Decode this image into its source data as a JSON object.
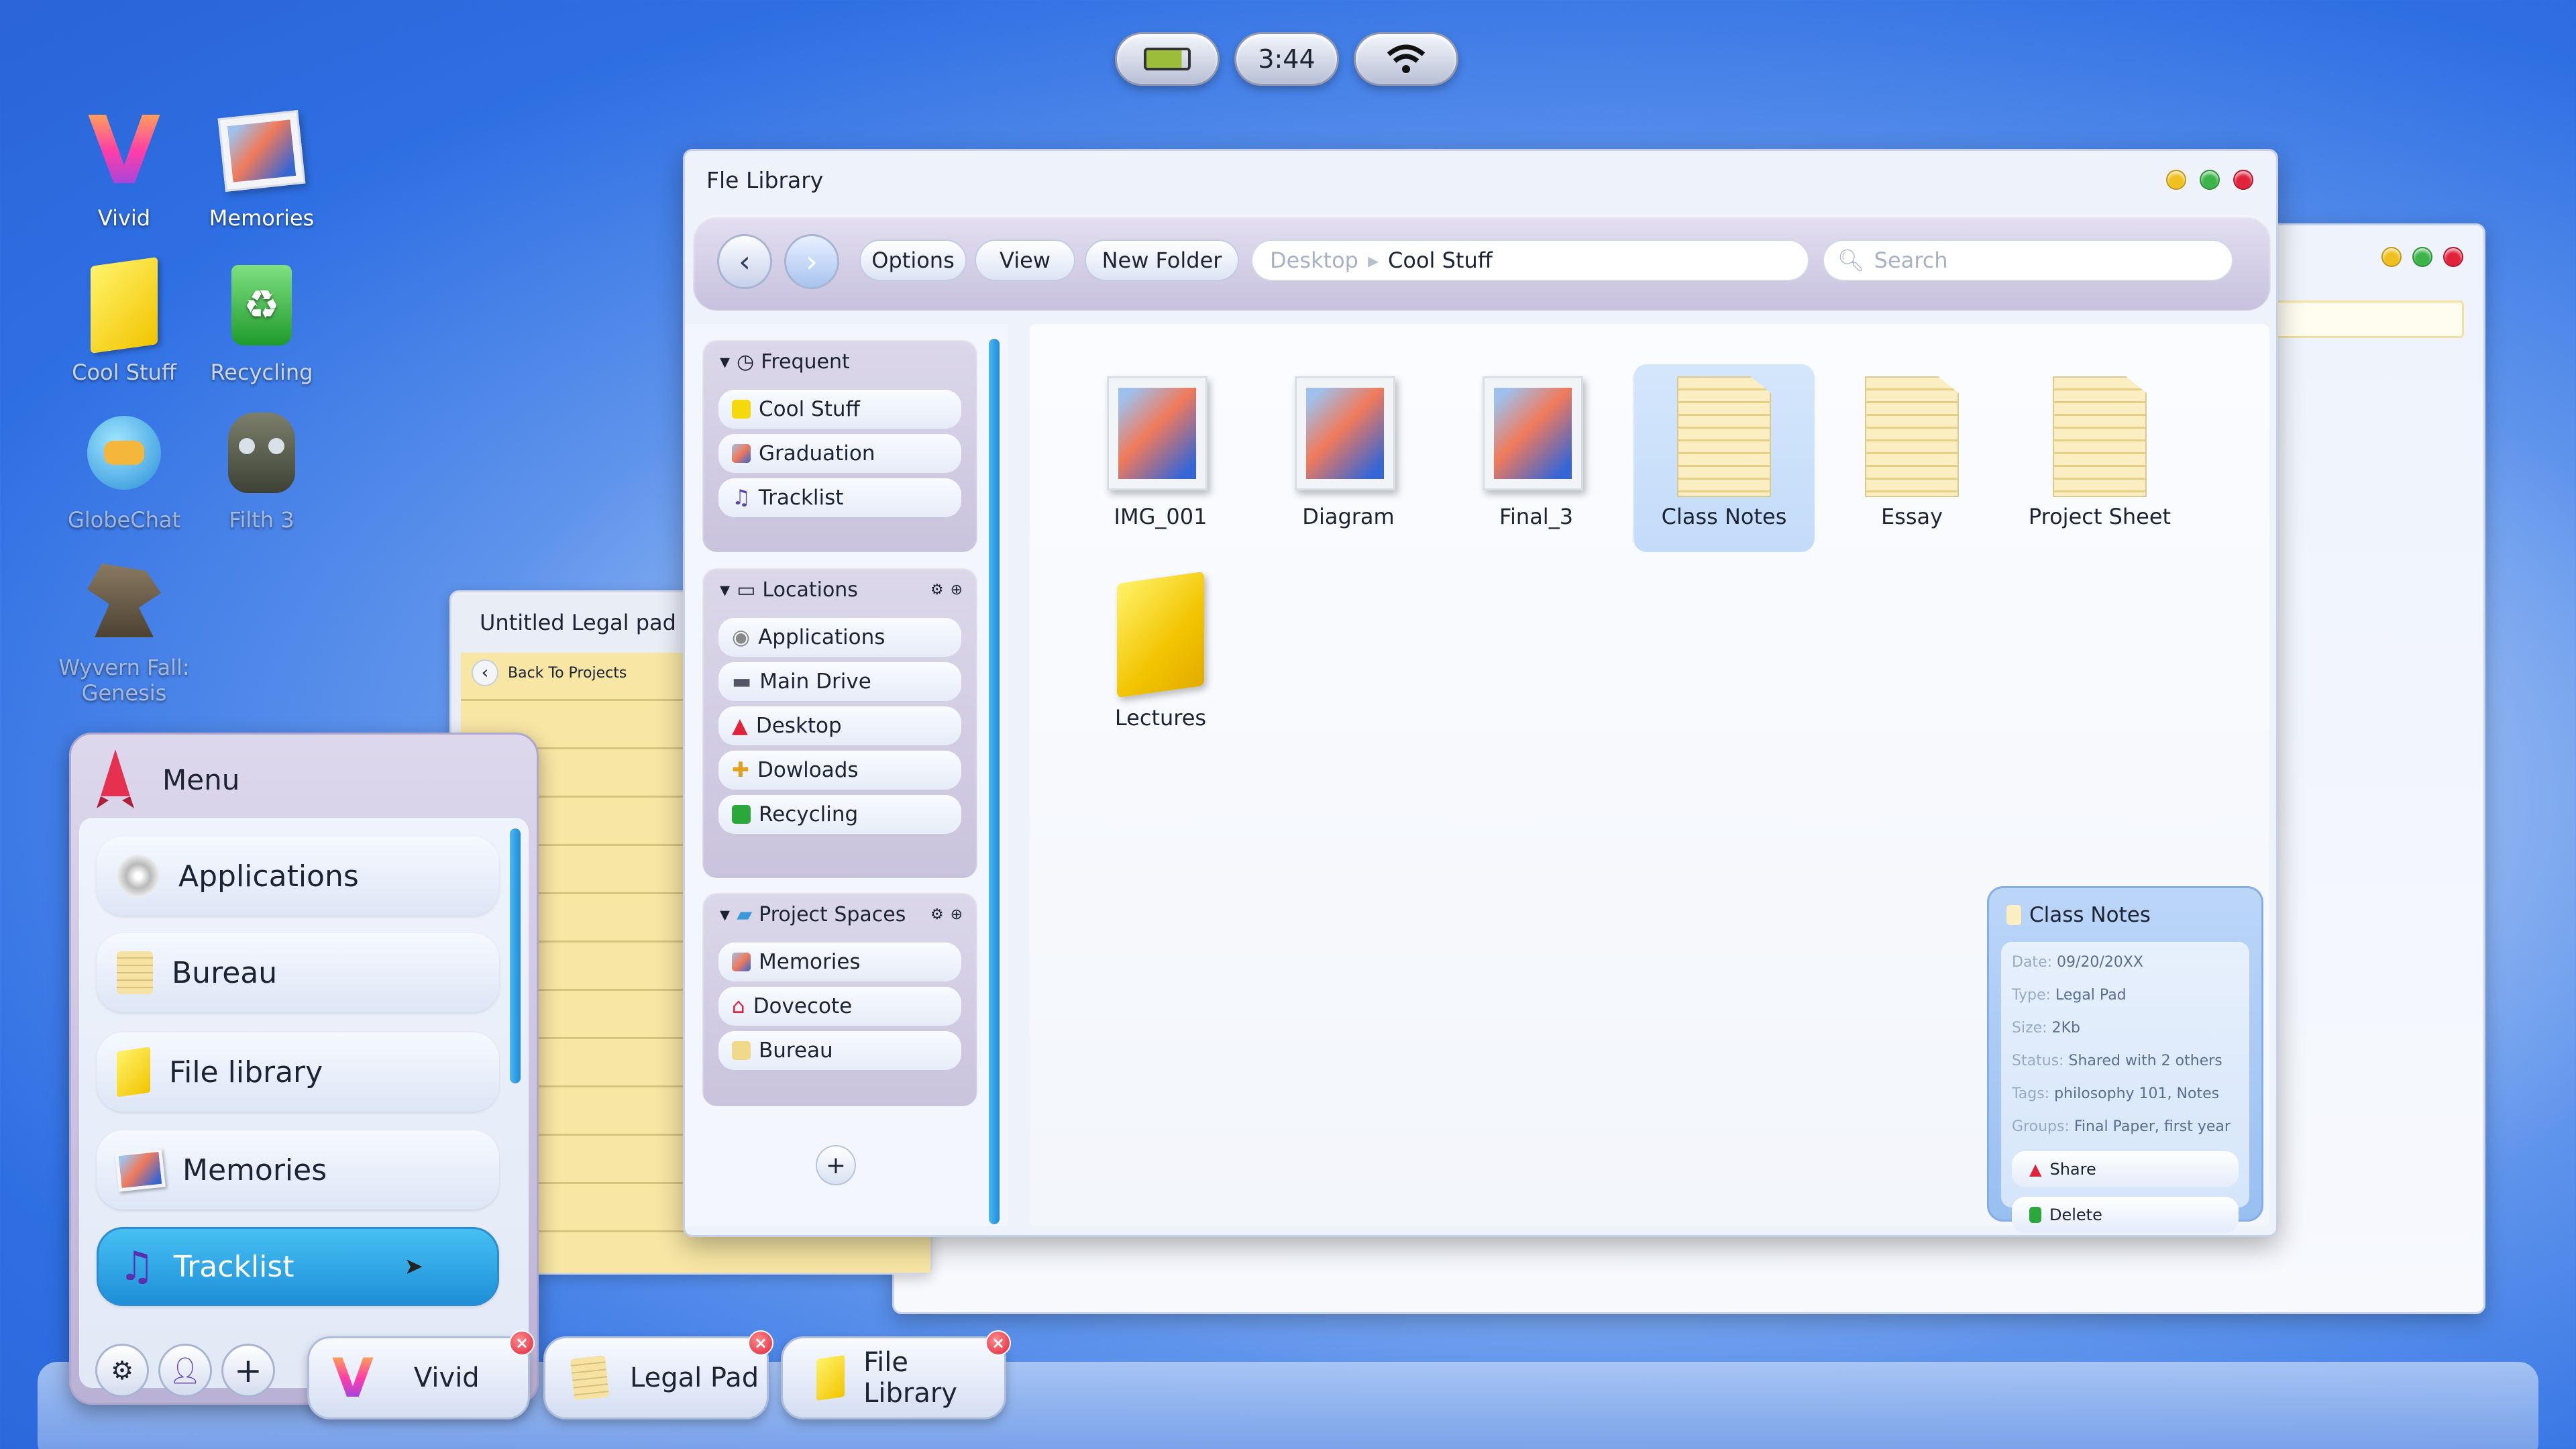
{
  "status": {
    "time": "3:44"
  },
  "desktop": {
    "icons": [
      {
        "label": "Vivid"
      },
      {
        "label": "Memories"
      },
      {
        "label": "Cool Stuff"
      },
      {
        "label": "Recycling"
      },
      {
        "label": "GlobeChat"
      },
      {
        "label": "Filth 3"
      },
      {
        "label": "Wyvern Fall: Genesis"
      }
    ]
  },
  "legal_pad": {
    "title": "Untitled Legal pad",
    "back_label": "Back To Projects"
  },
  "file_library": {
    "title": "Fle Library",
    "toolbar": {
      "options": "Options",
      "view": "View",
      "new_folder": "New Folder"
    },
    "path": {
      "parent": "Desktop",
      "current": "Cool Stuff"
    },
    "search_placeholder": "Search",
    "sidebar": {
      "frequent": {
        "title": "Frequent",
        "items": [
          "Cool Stuff",
          "Graduation",
          "Tracklist"
        ]
      },
      "locations": {
        "title": "Locations",
        "items": [
          "Applications",
          "Main Drive",
          "Desktop",
          "Dowloads",
          "Recycling"
        ]
      },
      "project_spaces": {
        "title": "Project Spaces",
        "items": [
          "Memories",
          "Dovecote",
          "Bureau"
        ]
      }
    },
    "files": [
      {
        "name": "IMG_001",
        "kind": "image"
      },
      {
        "name": "Diagram",
        "kind": "image"
      },
      {
        "name": "Final_3",
        "kind": "image"
      },
      {
        "name": "Class Notes",
        "kind": "doc"
      },
      {
        "name": "Essay",
        "kind": "doc"
      },
      {
        "name": "Project Sheet",
        "kind": "doc"
      },
      {
        "name": "Lectures",
        "kind": "folder"
      }
    ],
    "info": {
      "title": "Class Notes",
      "date_k": "Date:",
      "date_v": "09/20/20XX",
      "type_k": "Type:",
      "type_v": "Legal Pad",
      "size_k": "Size:",
      "size_v": "2Kb",
      "status_k": "Status:",
      "status_v": "Shared with 2 others",
      "tags_k": "Tags:",
      "tags_v": "philosophy 101, Notes",
      "groups_k": "Groups:",
      "groups_v": "Final Paper, first year",
      "share": "Share",
      "delete": "Delete"
    }
  },
  "menu": {
    "title": "Menu",
    "items": [
      "Applications",
      "Bureau",
      "File library",
      "Memories",
      "Tracklist"
    ]
  },
  "taskbar": {
    "items": [
      "Vivid",
      "Legal Pad",
      "File Library"
    ]
  },
  "colors": {
    "accent": "#1e8fd8",
    "folder": "#f5d90a",
    "close": "#e0223a",
    "minimize": "#f0c020",
    "maximize": "#3cb44a"
  }
}
